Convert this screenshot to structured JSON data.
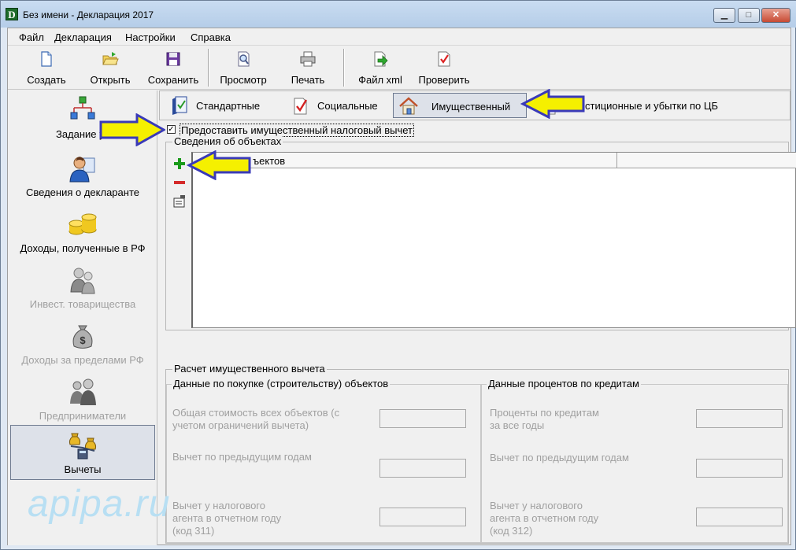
{
  "window": {
    "app_icon_letter": "D",
    "title": "Без имени - Декларация 2017",
    "minimize_symbol": "▁",
    "maximize_symbol": "□",
    "close_symbol": "✕"
  },
  "menu": [
    "Файл",
    "Декларация",
    "Настройки",
    "Справка"
  ],
  "toolbar": [
    {
      "label": "Создать",
      "icon": "new-document-icon"
    },
    {
      "label": "Открыть",
      "icon": "open-folder-icon"
    },
    {
      "label": "Сохранить",
      "icon": "save-disk-icon"
    },
    {
      "label": "Просмотр",
      "icon": "preview-magnifier-icon"
    },
    {
      "label": "Печать",
      "icon": "printer-icon"
    },
    {
      "label": "Файл xml",
      "icon": "xml-file-icon"
    },
    {
      "label": "Проверить",
      "icon": "check-document-icon"
    }
  ],
  "nav": [
    {
      "label": "Задание ус",
      "icon": "tree-structure-icon",
      "enabled": true
    },
    {
      "label": "Сведения о декларанте",
      "icon": "person-icon",
      "enabled": true
    },
    {
      "label": "Доходы, полученные в РФ",
      "icon": "coins-icon",
      "enabled": true
    },
    {
      "label": "Инвест. товарищества",
      "icon": "partners-icon",
      "enabled": false
    },
    {
      "label": "Доходы за пределами РФ",
      "icon": "money-bag-icon",
      "enabled": false
    },
    {
      "label": "Предприниматели",
      "icon": "business-people-icon",
      "enabled": false
    },
    {
      "label": "Вычеты",
      "icon": "scales-icon",
      "enabled": true,
      "active": true
    }
  ],
  "tabs": [
    {
      "label": "Стандартные",
      "icon": "standard-deduction-icon"
    },
    {
      "label": "Социальные",
      "icon": "social-deduction-icon"
    },
    {
      "label": "Имущественный",
      "icon": "house-icon",
      "active": true
    },
    {
      "label": "стиционные и убытки по ЦБ",
      "icon": "investment-icon"
    }
  ],
  "checkbox": {
    "label": "Предоставить имущественный налоговый вычет",
    "checked": true,
    "check_mark": "✓"
  },
  "objects_group": {
    "title": "Сведения об объектах",
    "column_header": "ъектов"
  },
  "calc_group": {
    "title": "Расчет имущественного вычета",
    "purchase": {
      "title": "Данные по покупке (строительству) объектов",
      "fields": [
        {
          "label_lines": [
            "Общая стоимость всех объектов (с",
            "учетом ограничений вычета)"
          ],
          "value": ""
        },
        {
          "label_lines": [
            "Вычет по предыдущим годам"
          ],
          "value": ""
        },
        {
          "label_lines": [
            "Вычет у налогового",
            "агента в отчетном году",
            "(код 311)"
          ],
          "value": ""
        }
      ]
    },
    "credit": {
      "title": "Данные процентов по кредитам",
      "fields": [
        {
          "label_lines": [
            "Проценты по кредитам",
            "за все годы"
          ],
          "value": ""
        },
        {
          "label_lines": [
            "Вычет по предыдущим годам"
          ],
          "value": ""
        },
        {
          "label_lines": [
            "Вычет у налогового",
            "агента в отчетном году",
            "(код 312)"
          ],
          "value": ""
        }
      ]
    }
  },
  "watermark": "apipa.ru",
  "colors": {
    "arrow_fill": "#f5f000",
    "arrow_stroke": "#3a3ab8",
    "add_green": "#1a9a1a",
    "remove_red": "#d42a2a"
  }
}
